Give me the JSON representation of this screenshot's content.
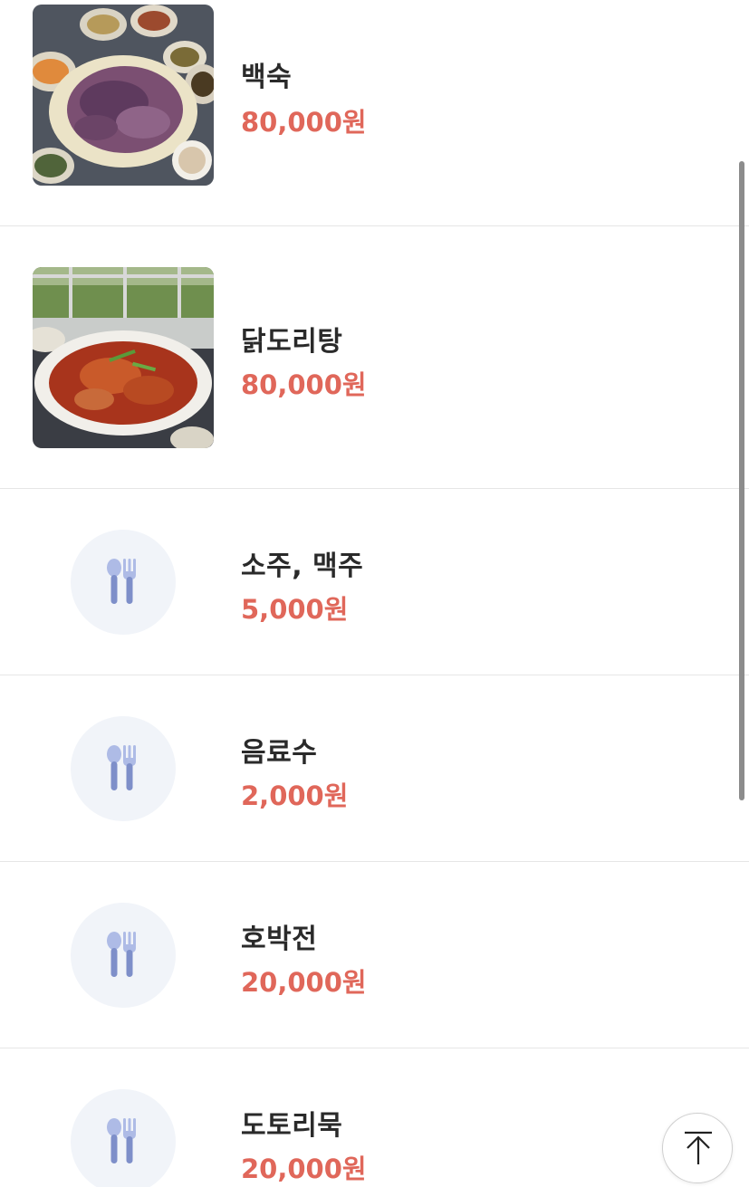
{
  "menu": {
    "items": [
      {
        "name": "백숙",
        "price": "80,000원",
        "image": "photo-boiled-chicken"
      },
      {
        "name": "닭도리탕",
        "price": "80,000원",
        "image": "photo-spicy-braised-chicken"
      },
      {
        "name": "소주, 맥주",
        "price": "5,000원",
        "image": "utensils-icon"
      },
      {
        "name": "음료수",
        "price": "2,000원",
        "image": "utensils-icon"
      },
      {
        "name": "호박전",
        "price": "20,000원",
        "image": "utensils-icon"
      },
      {
        "name": "도토리묵",
        "price": "20,000원",
        "image": "utensils-icon"
      }
    ]
  },
  "scroll_top_button": {
    "icon": "arrow-up-icon"
  },
  "colors": {
    "price": "#e0675a",
    "name": "#2a2a2a",
    "placeholder_bg": "#f1f4f9",
    "utensil": "#7e8fc9",
    "divider": "#e6e6e6"
  }
}
